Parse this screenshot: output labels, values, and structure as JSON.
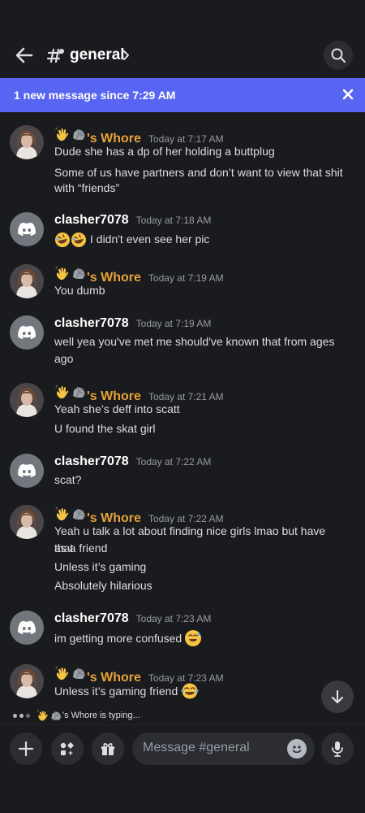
{
  "header": {
    "channel_name": "general"
  },
  "banner": {
    "text": "1 new message since 7:29 AM"
  },
  "whore_name": "'s Whore",
  "clasher_name": "clasher7078",
  "messages": [
    {
      "user": "whore",
      "timestamp": "Today at 7:17 AM",
      "lines": [
        "Dude she has a dp of her holding a buttplug",
        "Some of us have partners and don’t want to view that shit",
        "with “friends”"
      ]
    },
    {
      "user": "clasher",
      "timestamp": "Today at 7:18 AM",
      "lines": [
        "I didn't even see her pic"
      ]
    },
    {
      "user": "whore",
      "timestamp": "Today at 7:19 AM",
      "lines": [
        "You dumb"
      ]
    },
    {
      "user": "clasher",
      "timestamp": "Today at 7:19 AM",
      "lines": [
        "well yea you've met me should've known that from ages",
        "ago"
      ]
    },
    {
      "user": "whore",
      "timestamp": "Today at 7:21 AM",
      "lines": [
        "Yeah she’s deff into scatt",
        "U found the skat girl"
      ]
    },
    {
      "user": "clasher",
      "timestamp": "Today at 7:22 AM",
      "lines": [
        "scat?"
      ]
    },
    {
      "user": "whore",
      "timestamp": "Today at 7:22 AM",
      "lines": [
        "Yeah u talk a lot about finding nice girls lmao but have that",
        "as a friend",
        "Unless it’s gaming",
        "Absolutely hilarious"
      ]
    },
    {
      "user": "clasher",
      "timestamp": "Today at 7:23 AM",
      "lines": [
        "im getting more confused"
      ]
    },
    {
      "user": "whore",
      "timestamp": "Today at 7:23 AM",
      "lines": [
        "Unless it’s gaming friend"
      ]
    }
  ],
  "typing": {
    "text": "'s Whore is typing..."
  },
  "composer": {
    "placeholder": "Message #general"
  },
  "icons": [
    "back-arrow-icon",
    "channel-hash-icon",
    "search-icon",
    "close-icon",
    "wave-emoji-icon",
    "rock-emoji-icon",
    "discord-logo-icon",
    "rofl-emoji-icon",
    "sweat-smile-emoji-icon",
    "tears-of-joy-emoji-icon",
    "arrow-down-icon",
    "plus-icon",
    "apps-icon",
    "gift-icon",
    "emoji-icon",
    "microphone-icon"
  ],
  "colors": {
    "background": "#1a1b1e",
    "banner": "#5865f2",
    "username_accent": "#e5a23a",
    "text": "#dbdee1",
    "muted": "#949ba4"
  }
}
